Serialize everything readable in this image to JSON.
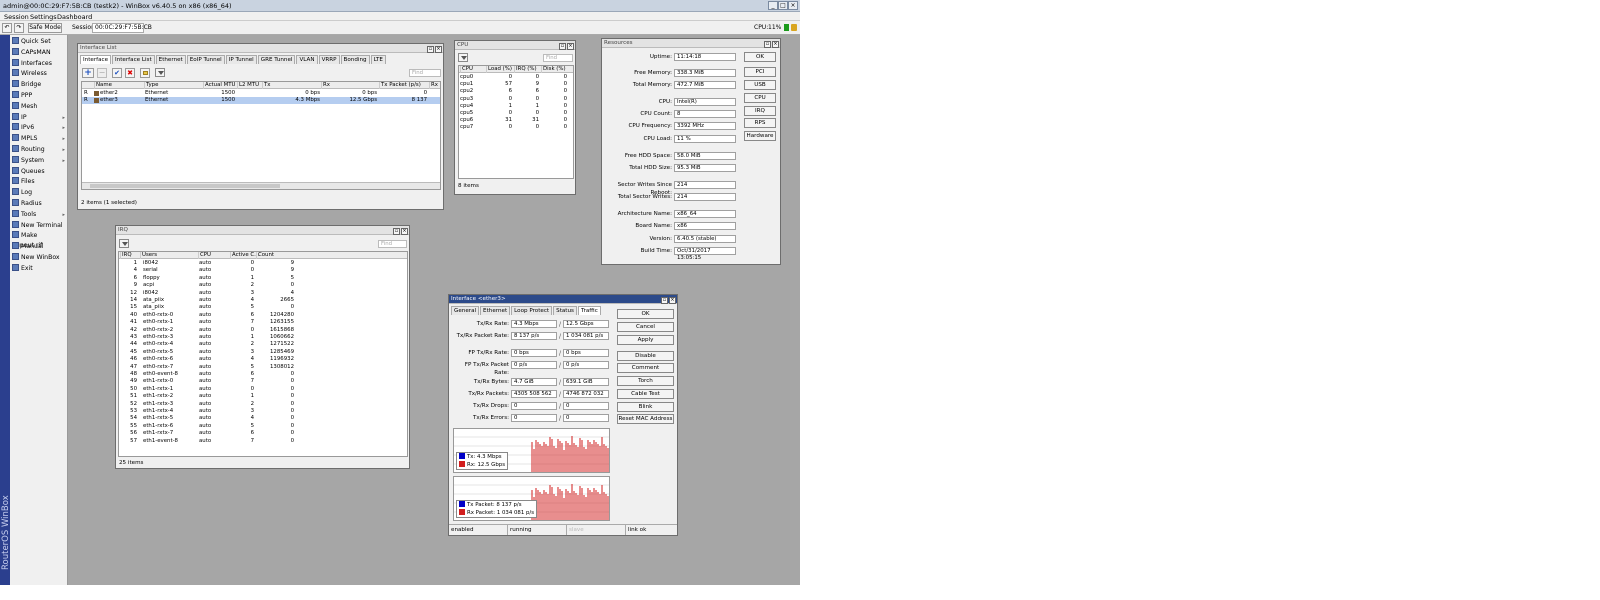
{
  "app": {
    "title": "admin@00:0C:29:F7:5B:CB (testk2) - WinBox v6.40.5 on x86 (x86_64)",
    "cpu_label": "CPU:",
    "cpu_value": "11%",
    "vertical_brand": "RouterOS WinBox"
  },
  "menu": {
    "session": "Session",
    "settings": "Settings",
    "dashboard": "Dashboard"
  },
  "toolbar": {
    "undo": "↶",
    "redo": "↷",
    "safe_mode": "Safe Mode",
    "session_label": "Session:",
    "session_value": "00:0C:29:F7:5B:CB"
  },
  "sidebar": {
    "items": [
      {
        "label": "Quick Set",
        "arrow": ""
      },
      {
        "label": "CAPsMAN",
        "arrow": ""
      },
      {
        "label": "Interfaces",
        "arrow": ""
      },
      {
        "label": "Wireless",
        "arrow": ""
      },
      {
        "label": "Bridge",
        "arrow": ""
      },
      {
        "label": "PPP",
        "arrow": ""
      },
      {
        "label": "Mesh",
        "arrow": ""
      },
      {
        "label": "IP",
        "arrow": "▸"
      },
      {
        "label": "IPv6",
        "arrow": "▸"
      },
      {
        "label": "MPLS",
        "arrow": "▸"
      },
      {
        "label": "Routing",
        "arrow": "▸"
      },
      {
        "label": "System",
        "arrow": "▸"
      },
      {
        "label": "Queues",
        "arrow": ""
      },
      {
        "label": "Files",
        "arrow": ""
      },
      {
        "label": "Log",
        "arrow": ""
      },
      {
        "label": "Radius",
        "arrow": ""
      },
      {
        "label": "Tools",
        "arrow": "▸"
      },
      {
        "label": "New Terminal",
        "arrow": ""
      },
      {
        "label": "Make Supout.rif",
        "arrow": ""
      },
      {
        "label": "Manual",
        "arrow": ""
      },
      {
        "label": "New WinBox",
        "arrow": ""
      },
      {
        "label": "Exit",
        "arrow": ""
      }
    ]
  },
  "iflist": {
    "title": "Interface List",
    "tabs": [
      "Interface",
      "Interface List",
      "Ethernet",
      "EoIP Tunnel",
      "IP Tunnel",
      "GRE Tunnel",
      "VLAN",
      "VRRP",
      "Bonding",
      "LTE"
    ],
    "find": "Find",
    "columns": [
      "Name",
      "Type",
      "Actual MTU",
      "L2 MTU",
      "Tx",
      "Rx",
      "Tx Packet (p/s)",
      "Rx"
    ],
    "rows": [
      {
        "flag": "R",
        "name": "ether2",
        "type": "Ethernet",
        "mtu": "1500",
        "l2mtu": "",
        "tx": "0 bps",
        "rx": "0 bps",
        "txp": "0"
      },
      {
        "flag": "R",
        "name": "ether3",
        "type": "Ethernet",
        "mtu": "1500",
        "l2mtu": "",
        "tx": "4.3 Mbps",
        "rx": "12.5 Gbps",
        "txp": "8 137"
      }
    ],
    "status": "2 items (1 selected)"
  },
  "cpu": {
    "title": "CPU",
    "find": "Find",
    "columns": [
      "CPU",
      "Load (%)",
      "IRQ (%)",
      "Disk (%)"
    ],
    "rows": [
      [
        "cpu0",
        "0",
        "0",
        "0"
      ],
      [
        "cpu1",
        "57",
        "9",
        "0"
      ],
      [
        "cpu2",
        "6",
        "6",
        "0"
      ],
      [
        "cpu3",
        "0",
        "0",
        "0"
      ],
      [
        "cpu4",
        "1",
        "1",
        "0"
      ],
      [
        "cpu5",
        "0",
        "0",
        "0"
      ],
      [
        "cpu6",
        "31",
        "31",
        "0"
      ],
      [
        "cpu7",
        "0",
        "0",
        "0"
      ]
    ],
    "status": "8 items"
  },
  "resources": {
    "title": "Resources",
    "fields": [
      {
        "label": "Uptime:",
        "value": "11:14:18"
      },
      {
        "label": "Free Memory:",
        "value": "338.3 MiB"
      },
      {
        "label": "Total Memory:",
        "value": "472.7 MiB"
      },
      {
        "label": "CPU:",
        "value": "Intel(R)"
      },
      {
        "label": "CPU Count:",
        "value": "8"
      },
      {
        "label": "CPU Frequency:",
        "value": "3392 MHz"
      },
      {
        "label": "CPU Load:",
        "value": "11 %"
      },
      {
        "label": "Free HDD Space:",
        "value": "58.0 MiB"
      },
      {
        "label": "Total HDD Size:",
        "value": "95.3 MiB"
      },
      {
        "label": "Sector Writes Since Reboot:",
        "value": "214"
      },
      {
        "label": "Total Sector Writes:",
        "value": "214"
      },
      {
        "label": "Architecture Name:",
        "value": "x86_64"
      },
      {
        "label": "Board Name:",
        "value": "x86"
      },
      {
        "label": "Version:",
        "value": "6.40.5 (stable)"
      },
      {
        "label": "Build Time:",
        "value": "Oct/31/2017 13:05:15"
      }
    ],
    "buttons": [
      "OK",
      "PCI",
      "USB",
      "CPU",
      "IRQ",
      "RPS",
      "Hardware"
    ]
  },
  "irq": {
    "title": "IRQ",
    "find": "Find",
    "columns": [
      "IRQ",
      "Users",
      "CPU",
      "Active C...",
      "Count"
    ],
    "rows": [
      [
        "1",
        "i8042",
        "auto",
        "0",
        "9"
      ],
      [
        "4",
        "serial",
        "auto",
        "0",
        "9"
      ],
      [
        "6",
        "floppy",
        "auto",
        "1",
        "5"
      ],
      [
        "9",
        "acpi",
        "auto",
        "2",
        "0"
      ],
      [
        "12",
        "i8042",
        "auto",
        "3",
        "4"
      ],
      [
        "14",
        "ata_piix",
        "auto",
        "4",
        "2665"
      ],
      [
        "15",
        "ata_piix",
        "auto",
        "5",
        "0"
      ],
      [
        "40",
        "eth0-rxtx-0",
        "auto",
        "6",
        "1204280"
      ],
      [
        "41",
        "eth0-rxtx-1",
        "auto",
        "7",
        "1263155"
      ],
      [
        "42",
        "eth0-rxtx-2",
        "auto",
        "0",
        "1615868"
      ],
      [
        "43",
        "eth0-rxtx-3",
        "auto",
        "1",
        "1060662"
      ],
      [
        "44",
        "eth0-rxtx-4",
        "auto",
        "2",
        "1271522"
      ],
      [
        "45",
        "eth0-rxtx-5",
        "auto",
        "3",
        "1285469"
      ],
      [
        "46",
        "eth0-rxtx-6",
        "auto",
        "4",
        "1196932"
      ],
      [
        "47",
        "eth0-rxtx-7",
        "auto",
        "5",
        "1308012"
      ],
      [
        "48",
        "eth0-event-8",
        "auto",
        "6",
        "0"
      ],
      [
        "49",
        "eth1-rxtx-0",
        "auto",
        "7",
        "0"
      ],
      [
        "50",
        "eth1-rxtx-1",
        "auto",
        "0",
        "0"
      ],
      [
        "51",
        "eth1-rxtx-2",
        "auto",
        "1",
        "0"
      ],
      [
        "52",
        "eth1-rxtx-3",
        "auto",
        "2",
        "0"
      ],
      [
        "53",
        "eth1-rxtx-4",
        "auto",
        "3",
        "0"
      ],
      [
        "54",
        "eth1-rxtx-5",
        "auto",
        "4",
        "0"
      ],
      [
        "55",
        "eth1-rxtx-6",
        "auto",
        "5",
        "0"
      ],
      [
        "56",
        "eth1-rxtx-7",
        "auto",
        "6",
        "0"
      ],
      [
        "57",
        "eth1-event-8",
        "auto",
        "7",
        "0"
      ]
    ],
    "status": "25 items"
  },
  "ifwin": {
    "title": "Interface <ether3>",
    "tabs": [
      "General",
      "Ethernet",
      "Loop Protect",
      "Status",
      "Traffic"
    ],
    "rows": [
      {
        "label": "Tx/Rx Rate:",
        "a": "4.3 Mbps",
        "b": "12.5 Gbps"
      },
      {
        "label": "Tx/Rx Packet Rate:",
        "a": "8 137 p/s",
        "b": "1 034 081 p/s"
      },
      {
        "label": "FP Tx/Rx Rate:",
        "a": "0 bps",
        "b": "0 bps"
      },
      {
        "label": "FP Tx/Rx Packet Rate:",
        "a": "0 p/s",
        "b": "0 p/s"
      },
      {
        "label": "Tx/Rx Bytes:",
        "a": "4.7 GiB",
        "b": "639.1 GiB"
      },
      {
        "label": "Tx/Rx Packets:",
        "a": "4305 508 562",
        "b": "4746 872 032"
      },
      {
        "label": "Tx/Rx Drops:",
        "a": "0",
        "b": "0"
      },
      {
        "label": "Tx/Rx Errors:",
        "a": "0",
        "b": "0"
      }
    ],
    "sep": "/",
    "buttons": [
      "OK",
      "Cancel",
      "Apply",
      "Disable",
      "Comment",
      "Torch",
      "Cable Test",
      "Blink",
      "Reset MAC Address"
    ],
    "legend1": {
      "tx": "Tx:   4.3 Mbps",
      "rx": "Rx:   12.5 Gbps"
    },
    "legend2": {
      "tx": "Tx Packet:  8 137 p/s",
      "rx": "Rx Packet:  1 034 081 p/s"
    },
    "status": [
      "enabled",
      "running",
      "slave",
      "link ok"
    ],
    "colors": {
      "tx": "#0000c8",
      "rx": "#d21e1e"
    }
  }
}
